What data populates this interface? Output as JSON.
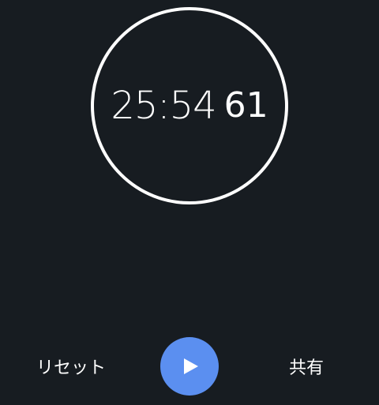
{
  "stopwatch": {
    "time_main": "25:54",
    "time_fraction": "61"
  },
  "controls": {
    "reset_label": "リセット",
    "share_label": "共有",
    "play_icon": "play-icon"
  },
  "colors": {
    "background": "#171c21",
    "ring": "#ffffff",
    "play_button": "#5b8ff0",
    "text": "#ffffff"
  }
}
